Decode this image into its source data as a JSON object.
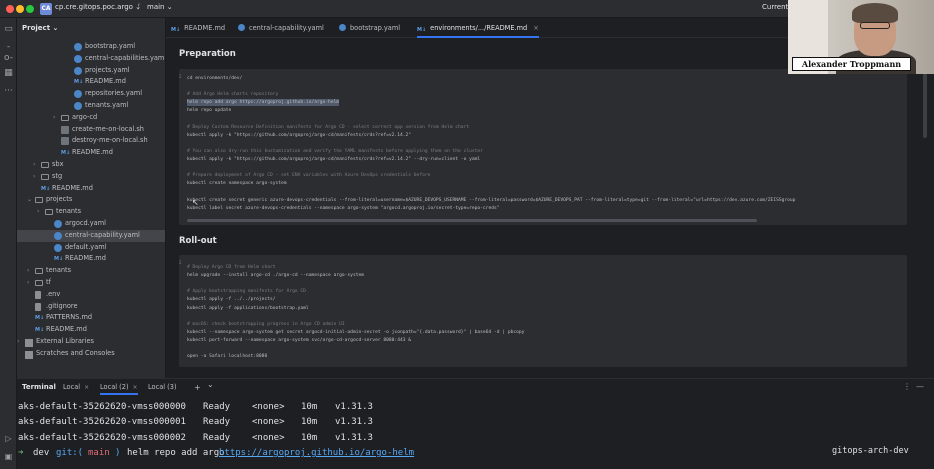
{
  "window": {
    "project_badge": "CA",
    "project_name": "cp.cre.gitops.poc.argo",
    "branch_icon": "git-branch-icon",
    "branch": "main",
    "right_text": "Current"
  },
  "project_panel": {
    "title": "Project",
    "items": [
      {
        "label": "bootstrap.yaml",
        "type": "yaml"
      },
      {
        "label": "central-capabilities.yaml",
        "type": "yaml"
      },
      {
        "label": "projects.yaml",
        "type": "yaml"
      },
      {
        "label": "README.md",
        "type": "md"
      },
      {
        "label": "repositories.yaml",
        "type": "yaml"
      },
      {
        "label": "tenants.yaml",
        "type": "yaml"
      },
      {
        "label": "argo-cd",
        "type": "folder"
      },
      {
        "label": "create-me-on-local.sh",
        "type": "sh"
      },
      {
        "label": "destroy-me-on-local.sh",
        "type": "sh"
      },
      {
        "label": "README.md",
        "type": "md"
      },
      {
        "label": "sbx",
        "type": "folder"
      },
      {
        "label": "stg",
        "type": "folder"
      },
      {
        "label": "README.md",
        "type": "md"
      },
      {
        "label": "projects",
        "type": "folder"
      },
      {
        "label": "tenants",
        "type": "folder"
      },
      {
        "label": "argocd.yaml",
        "type": "yaml"
      },
      {
        "label": "central-capability.yaml",
        "type": "yaml"
      },
      {
        "label": "default.yaml",
        "type": "yaml"
      },
      {
        "label": "README.md",
        "type": "md"
      },
      {
        "label": "tenants",
        "type": "folder"
      },
      {
        "label": "tf",
        "type": "folder"
      },
      {
        "label": ".env",
        "type": "file"
      },
      {
        "label": ".gitignore",
        "type": "file"
      },
      {
        "label": "PATTERNS.md",
        "type": "md"
      },
      {
        "label": "README.md",
        "type": "md"
      },
      {
        "label": "External Libraries",
        "type": "lib"
      },
      {
        "label": "Scratches and Consoles",
        "type": "lib"
      }
    ]
  },
  "tabs": [
    {
      "label": "README.md",
      "type": "md"
    },
    {
      "label": "central-capability.yaml",
      "type": "yaml"
    },
    {
      "label": "bootstrap.yaml",
      "type": "yaml"
    },
    {
      "label": "environments/.../README.md",
      "type": "md",
      "active": true
    }
  ],
  "editor": {
    "preparation_heading": "Preparation",
    "preparation_code": [
      {
        "text": "cd environments/dev/",
        "kind": "code"
      },
      {
        "text": "",
        "kind": "blank"
      },
      {
        "text": "# Add Argo Helm charts repository",
        "kind": "comment"
      },
      {
        "text": "helm repo add argo https://argoproj.github.io/argo-helm",
        "kind": "highlight"
      },
      {
        "text": "helm repo update",
        "kind": "code"
      },
      {
        "text": "",
        "kind": "blank"
      },
      {
        "text": "# Deploy Custom Resource Definition manifests for Argo CD - select correct app version from Helm chart",
        "kind": "comment"
      },
      {
        "text": "kubectl apply -k \"https://github.com/argoproj/argo-cd/manifests/crds?ref=v2.14.2\"",
        "kind": "code"
      },
      {
        "text": "",
        "kind": "blank"
      },
      {
        "text": "# You can also dry-run this kustomization and verify the YAML manifests before applying them on the cluster",
        "kind": "comment"
      },
      {
        "text": "kubectl apply -k \"https://github.com/argoproj/argo-cd/manifests/crds?ref=v2.14.2\" --dry-run=client -o yaml",
        "kind": "code"
      },
      {
        "text": "",
        "kind": "blank"
      },
      {
        "text": "# Prepare deployment of Argo CD - set ENV variables with Azure DevOps credentials before",
        "kind": "comment"
      },
      {
        "text": "kubectl create namespace argo-system",
        "kind": "code"
      },
      {
        "text": "",
        "kind": "blank"
      },
      {
        "text": "kubectl create secret generic azure-devops-credentials --from-literal=username=$AZURE_DEVOPS_USERNAME --from-literal=password=$AZURE_DEVOPS_PAT --from-literal=type=git --from-literal=\"url=https://dev.azure.com/ZEISSgroup",
        "kind": "code"
      },
      {
        "text": "kubectl label secret azure-devops-credentials --namespace argo-system \"argocd.argoproj.io/secret-type=repo-creds\"",
        "kind": "code"
      }
    ],
    "rollout_heading": "Roll-out",
    "rollout_code": [
      {
        "text": "# Deploy Argo CD from Helm chart",
        "kind": "comment"
      },
      {
        "text": "helm upgrade --install argo-cd ./argo-cd --namespace argo-system",
        "kind": "code"
      },
      {
        "text": "",
        "kind": "blank"
      },
      {
        "text": "# Apply bootstrapping manifests for Argo CD",
        "kind": "comment"
      },
      {
        "text": "kubectl apply -f ../../projects/",
        "kind": "code"
      },
      {
        "text": "kubectl apply -f applications/bootstrap.yaml",
        "kind": "code"
      },
      {
        "text": "",
        "kind": "blank"
      },
      {
        "text": "# macOS: check bootstrapping progress in Argo CD admin UI",
        "kind": "comment"
      },
      {
        "text": "kubectl --namespace argo-system get secret argocd-initial-admin-secret -o jsonpath=\"{.data.password}\" | base64 -d | pbcopy",
        "kind": "code"
      },
      {
        "text": "kubectl port-forward --namespace argo-system svc/argo-cd-argocd-server 8080:443 &",
        "kind": "code"
      },
      {
        "text": "",
        "kind": "blank"
      },
      {
        "text": "open -a Safari localhost:8080",
        "kind": "code"
      }
    ]
  },
  "video_overlay": {
    "name": "Alexander Troppmann"
  },
  "terminal": {
    "title": "Terminal",
    "tabs": [
      {
        "label": "Local"
      },
      {
        "label": "Local (2)",
        "active": true
      },
      {
        "label": "Local (3)"
      }
    ],
    "rows": [
      {
        "name": "aks-default-35262620-vmss000000",
        "status": "Ready",
        "roles": "<none>",
        "age": "10m",
        "version": "v1.31.3"
      },
      {
        "name": "aks-default-35262620-vmss000001",
        "status": "Ready",
        "roles": "<none>",
        "age": "10m",
        "version": "v1.31.3"
      },
      {
        "name": "aks-default-35262620-vmss000002",
        "status": "Ready",
        "roles": "<none>",
        "age": "10m",
        "version": "v1.31.3"
      }
    ],
    "prompt": {
      "arrow": "➜",
      "dir": "dev",
      "git_prefix": "git:(",
      "branch": "main",
      "git_suffix": ")",
      "command": "helm repo add argo",
      "url": "https://argoproj.github.io/argo-helm"
    },
    "right_status": "gitops-arch-dev"
  },
  "colors": {
    "accent": "#3574f0",
    "editor_bg": "#1e1f22",
    "panel_bg": "#2b2d30",
    "comment": "#7a7e85",
    "highlight": "#505a6b"
  }
}
